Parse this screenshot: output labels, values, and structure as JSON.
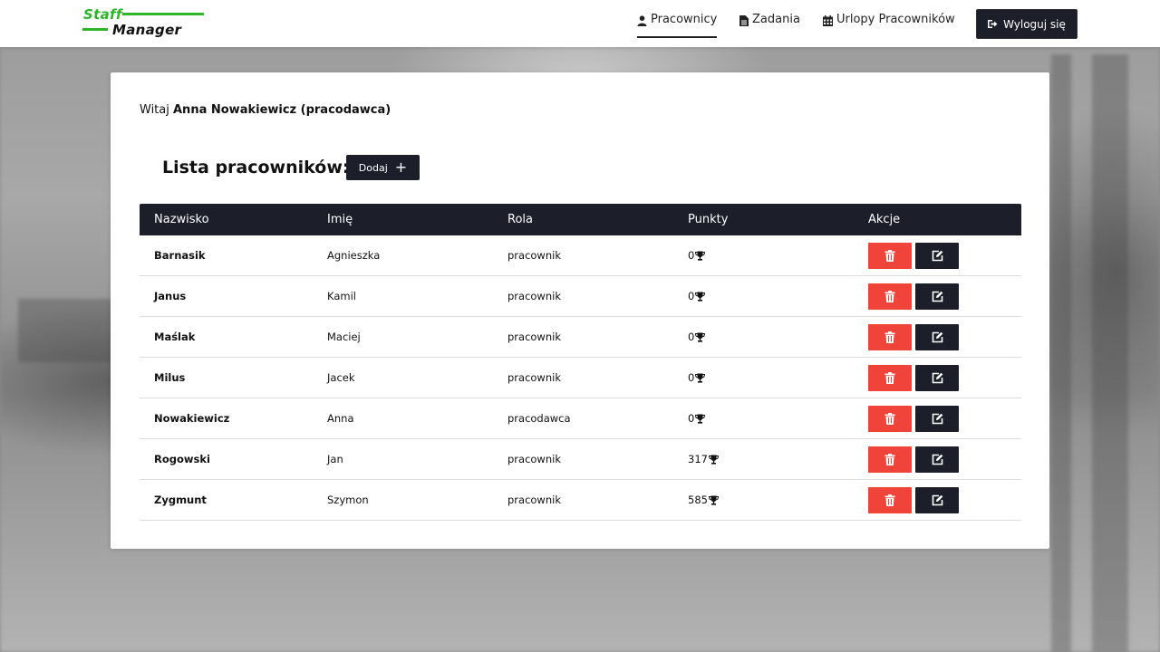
{
  "brand": {
    "line1": "Staff",
    "line2": "Manager",
    "accent": "#2db52a"
  },
  "nav": {
    "items": [
      {
        "label": "Pracownicy",
        "icon": "user-icon",
        "active": true
      },
      {
        "label": "Zadania",
        "icon": "file-icon",
        "active": false
      },
      {
        "label": "Urlopy Pracowników",
        "icon": "calendar-icon",
        "active": false
      }
    ],
    "logout_label": "Wyloguj się"
  },
  "welcome": {
    "prefix": "Witaj",
    "user": "Anna Nowakiewicz (pracodawca)"
  },
  "list": {
    "title": "Lista pracowników:",
    "add_label": "Dodaj",
    "columns": [
      "Nazwisko",
      "Imię",
      "Rola",
      "Punkty",
      "Akcje"
    ],
    "rows": [
      {
        "surname": "Barnasik",
        "name": "Agnieszka",
        "role": "pracownik",
        "points": "0"
      },
      {
        "surname": "Janus",
        "name": "Kamil",
        "role": "pracownik",
        "points": "0"
      },
      {
        "surname": "Maślak",
        "name": "Maciej",
        "role": "pracownik",
        "points": "0"
      },
      {
        "surname": "Milus",
        "name": "Jacek",
        "role": "pracownik",
        "points": "0"
      },
      {
        "surname": "Nowakiewicz",
        "name": "Anna",
        "role": "pracodawca",
        "points": "0"
      },
      {
        "surname": "Rogowski",
        "name": "Jan",
        "role": "pracownik",
        "points": "317"
      },
      {
        "surname": "Zygmunt",
        "name": "Szymon",
        "role": "pracownik",
        "points": "585"
      }
    ]
  },
  "colors": {
    "dark": "#1c1f2a",
    "delete": "#f0443a"
  }
}
